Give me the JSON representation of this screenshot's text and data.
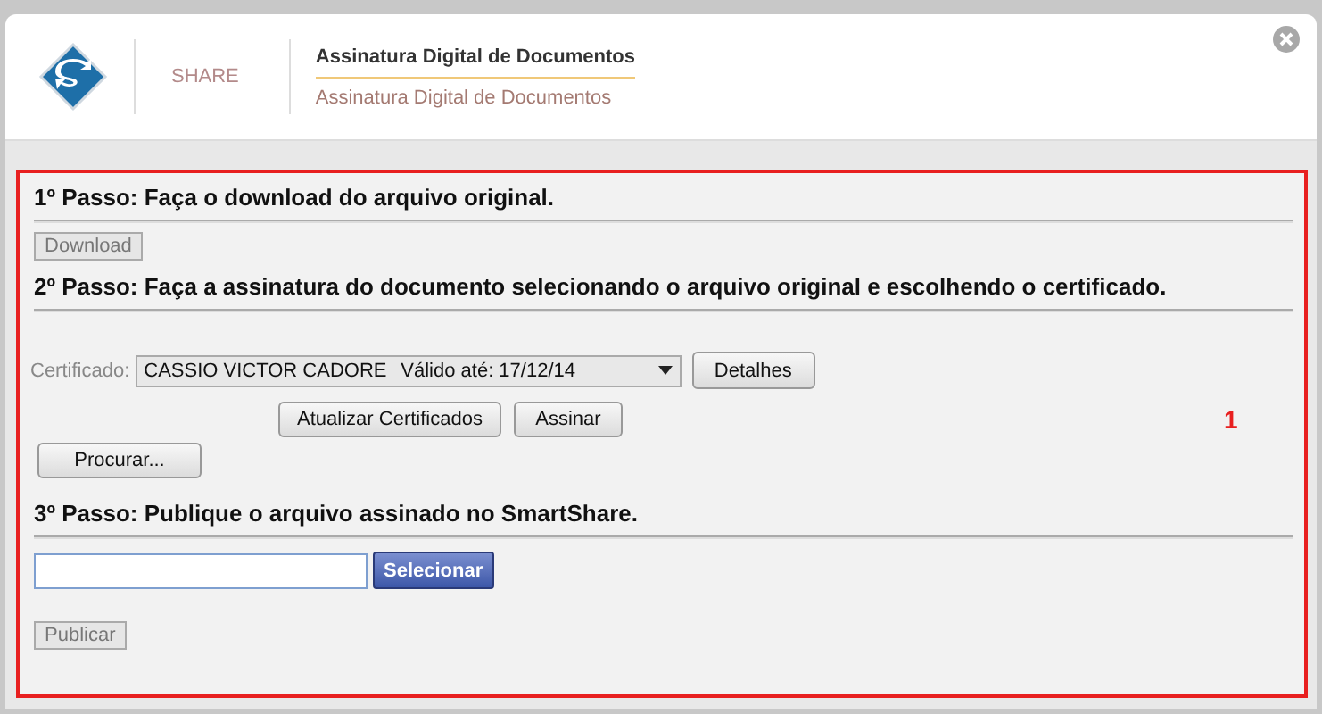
{
  "header": {
    "brand": "SHARE",
    "title": "Assinatura Digital de Documentos",
    "subtitle": "Assinatura Digital de Documentos"
  },
  "step1": {
    "heading": "1º Passo: Faça o download do arquivo original.",
    "button": {
      "label": "Download",
      "disabled": true
    }
  },
  "step2": {
    "heading": "2º Passo: Faça a assinatura do documento selecionando o arquivo original e escolhendo o certificado.",
    "certificate_label": "Certificado:",
    "certificate": {
      "name": "CASSIO VICTOR CADORE",
      "validity": "Válido até: 17/12/14"
    },
    "details_button": "Detalhes",
    "refresh_button": "Atualizar Certificados",
    "sign_button": "Assinar",
    "browse_button": "Procurar..."
  },
  "callout": "1",
  "step3": {
    "heading": "3º Passo: Publique o arquivo assinado no SmartShare.",
    "select_button": "Selecionar",
    "publish_button": {
      "label": "Publicar",
      "disabled": true
    }
  }
}
